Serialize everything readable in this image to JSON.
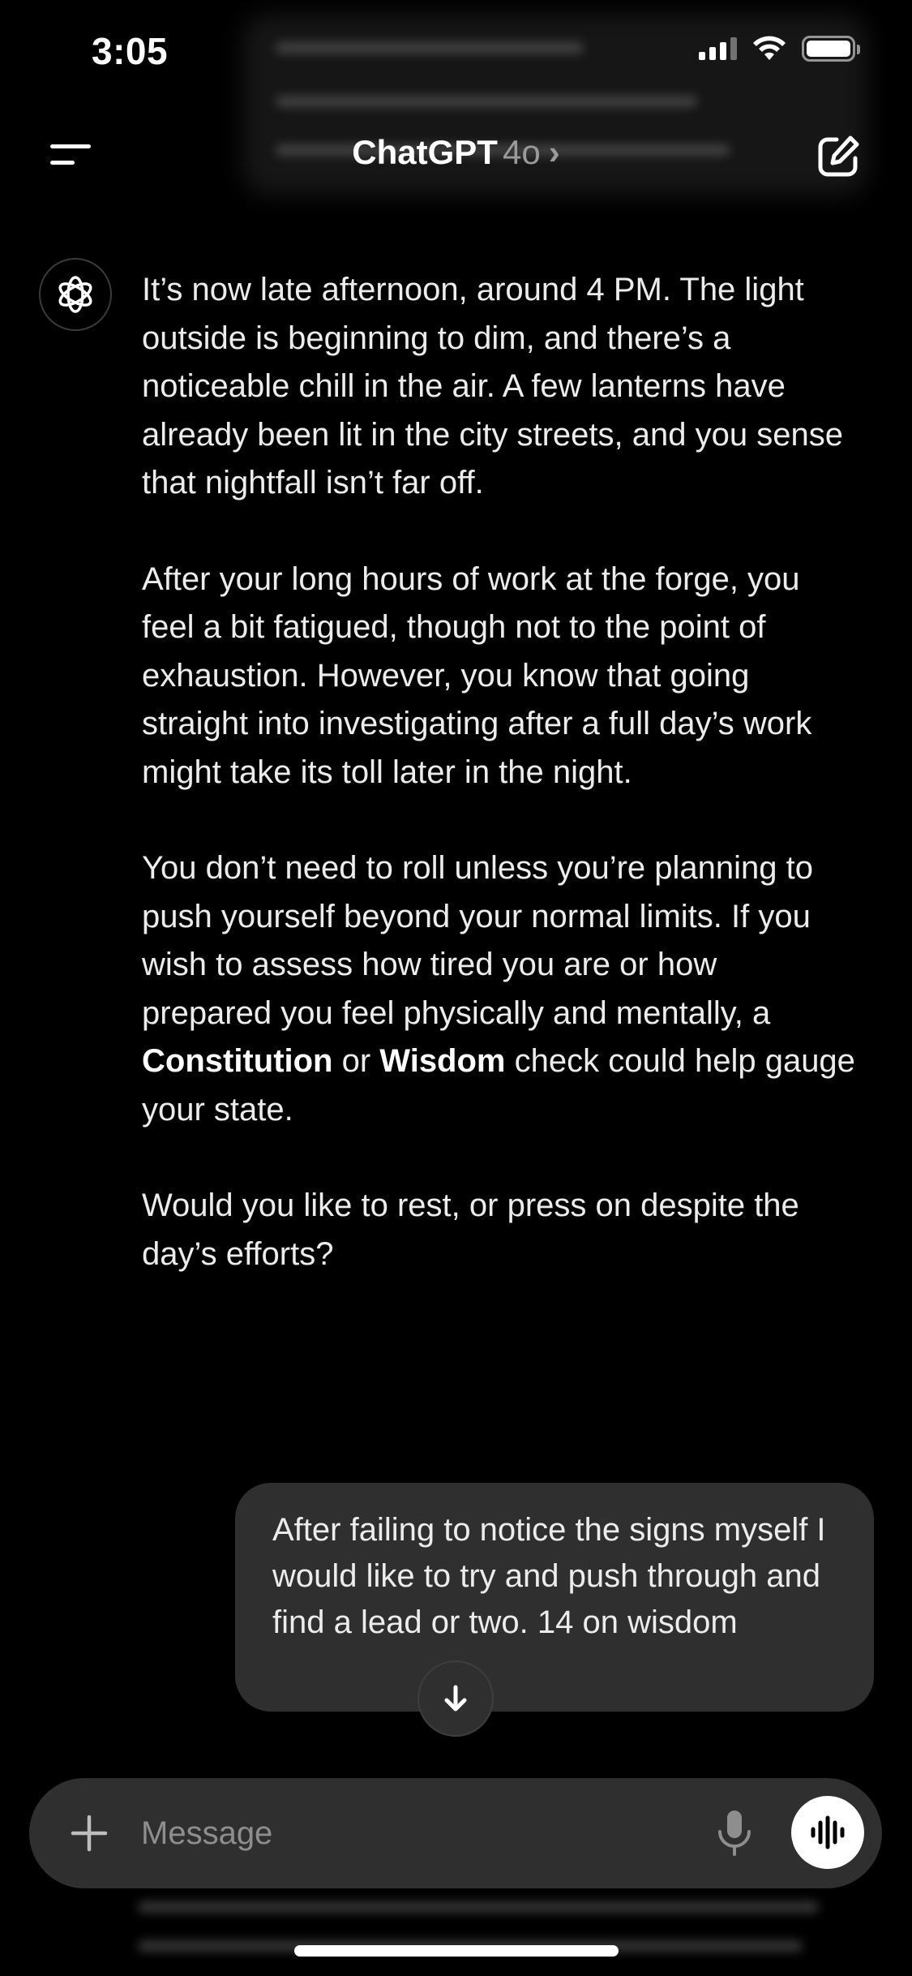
{
  "status_bar": {
    "time": "3:05"
  },
  "header": {
    "title": "ChatGPT",
    "model": "4o",
    "chevron": "›"
  },
  "assistant_message": {
    "paragraphs": [
      "It’s now late afternoon, around 4 PM. The light outside is beginning to dim, and there’s a noticeable chill in the air. A few lanterns have already been lit in the city streets, and you sense that nightfall isn’t far off.",
      "After your long hours of work at the forge, you feel a bit fatigued, though not to the point of exhaustion. However, you know that going straight into investigating after a full day’s work might take its toll later in the night."
    ],
    "p3_part1": "You don’t need to roll unless you’re planning to push yourself beyond your normal limits. If you wish to assess how tired you are or how prepared you feel physically and mentally, a ",
    "p3_bold1": "Constitution",
    "p3_part2": " or ",
    "p3_bold2": "Wisdom",
    "p3_part3": " check could help gauge your state.",
    "p4": "Would you like to rest, or press on despite the day’s efforts?"
  },
  "user_message": {
    "text": "After failing to notice the signs myself I would like to try and push through and find a lead or two. 14 on wisdom"
  },
  "composer": {
    "placeholder": "Message"
  },
  "icons": {
    "menu": "menu-icon",
    "new_chat": "new-chat-icon",
    "avatar": "openai-logo-icon",
    "scroll_down": "arrow-down-icon",
    "plus": "plus-icon",
    "mic": "microphone-icon",
    "voice": "voice-mode-icon"
  },
  "colors": {
    "background": "#000000",
    "bubble": "#2f2f2f",
    "text": "#ececec",
    "muted": "#8e8e8e"
  }
}
